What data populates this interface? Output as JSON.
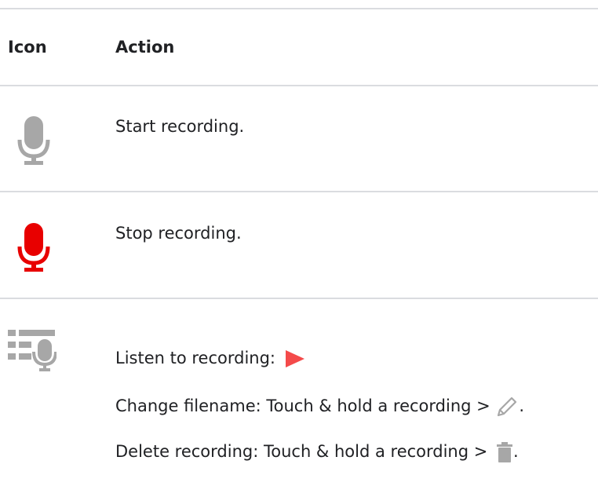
{
  "table": {
    "header": {
      "icon": "Icon",
      "action": "Action"
    },
    "rows": [
      {
        "icon": "microphone-icon-gray",
        "text": "Start recording."
      },
      {
        "icon": "microphone-icon-red",
        "text": "Stop recording."
      },
      {
        "icon": "recordings-list-icon",
        "listen_text": "Listen to recording:",
        "listen_icon": "play-icon",
        "rename_text": "Change filename: Touch & hold a recording >",
        "rename_icon": "pencil-icon",
        "rename_end": ".",
        "delete_text": "Delete recording: Touch & hold a recording >",
        "delete_icon": "trash-icon",
        "delete_end": "."
      }
    ]
  },
  "colors": {
    "divider": "#dadce0",
    "icon_gray": "#a7a7a7",
    "record_red": "#e80000",
    "play_red": "#f44a4a"
  }
}
